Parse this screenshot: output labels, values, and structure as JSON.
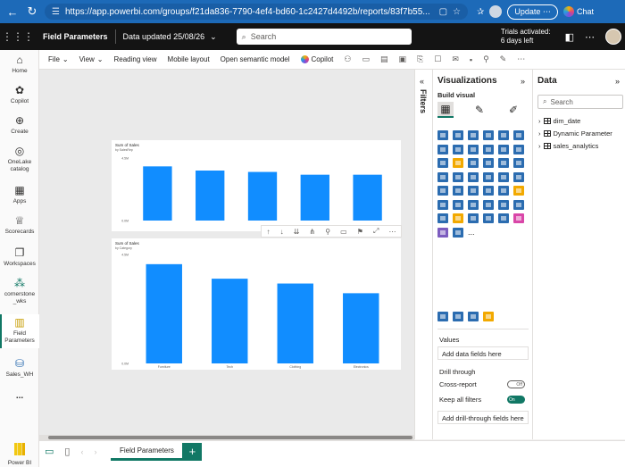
{
  "browser": {
    "url": "https://app.powerbi.com/groups/f21da836-7790-4ef4-bd60-1c2427d4492b/reports/83f7b55...",
    "update_label": "Update",
    "chat_label": "Chat"
  },
  "header": {
    "report_name": "Field Parameters",
    "updated_text": "Data updated 25/08/26",
    "search_placeholder": "Search",
    "trial_line1": "Trials activated:",
    "trial_line2": "6 days left"
  },
  "rail": [
    {
      "label": "Home"
    },
    {
      "label": "Copilot"
    },
    {
      "label": "Create"
    },
    {
      "label": "OneLake catalog"
    },
    {
      "label": "Apps"
    },
    {
      "label": "Scorecards"
    },
    {
      "label": "Workspaces"
    },
    {
      "label": "cornerstone _wks"
    },
    {
      "label": "Field Parameters"
    },
    {
      "label": "Sales_WH"
    },
    {
      "label": "..."
    },
    {
      "label": "Power BI"
    }
  ],
  "ribbon": {
    "file": "File",
    "view": "View",
    "reading_view": "Reading view",
    "mobile_layout": "Mobile layout",
    "open_model": "Open semantic model",
    "copilot": "Copilot"
  },
  "filters_label": "Filters",
  "viz": {
    "title": "Visualizations",
    "build_visual": "Build visual",
    "more": "...",
    "values_label": "Values",
    "add_data_fields": "Add data fields here",
    "drill_through": "Drill through",
    "cross_report": "Cross-report",
    "cross_report_state": "Off",
    "keep_filters": "Keep all filters",
    "keep_filters_state": "On",
    "add_drill": "Add drill-through fields here",
    "icon_colors": [
      "#2b6cb0",
      "#2b6cb0",
      "#2b6cb0",
      "#2b6cb0",
      "#2b6cb0",
      "#2b6cb0",
      "#2b6cb0",
      "#2b6cb0",
      "#2b6cb0",
      "#2b6cb0",
      "#2b6cb0",
      "#2b6cb0",
      "#2b6cb0",
      "#f2a900",
      "#2b6cb0",
      "#2b6cb0",
      "#2b6cb0",
      "#2b6cb0",
      "#2b6cb0",
      "#2b6cb0",
      "#2b6cb0",
      "#2b6cb0",
      "#2b6cb0",
      "#2b6cb0",
      "#2b6cb0",
      "#2b6cb0",
      "#2b6cb0",
      "#2b6cb0",
      "#2b6cb0",
      "#f2a900",
      "#2b6cb0",
      "#2b6cb0",
      "#2b6cb0",
      "#2b6cb0",
      "#2b6cb0",
      "#2b6cb0",
      "#2b6cb0",
      "#f2a900",
      "#2b6cb0",
      "#2b6cb0",
      "#2b6cb0",
      "#d946a8",
      "#7c5cbf",
      "#2b6cb0"
    ]
  },
  "data_pane": {
    "title": "Data",
    "search_placeholder": "Search",
    "tables": [
      "dim_date",
      "Dynamic Parameter",
      "sales_analytics"
    ]
  },
  "pages": {
    "active_tab": "Field Parameters"
  },
  "chart_data": [
    {
      "type": "bar",
      "title": "Sum of Sales",
      "subtitle": "by SalesRep",
      "categories": [
        "",
        "",
        "",
        "",
        ""
      ],
      "values": [
        3.9,
        3.6,
        3.5,
        3.3,
        3.3
      ],
      "ylim": [
        0,
        4.5
      ],
      "yticks": [
        "0.0M",
        "",
        "",
        "4.5M"
      ],
      "color": "#118dff"
    },
    {
      "type": "bar",
      "title": "Sum of Sales",
      "subtitle": "by Category",
      "categories": [
        "Furniture",
        "Tech",
        "Clothing",
        "Electronics"
      ],
      "values": [
        4.1,
        3.5,
        3.3,
        2.9
      ],
      "ylim": [
        0,
        4.5
      ],
      "yticks": [
        "0.0M",
        "",
        "",
        "",
        "4.5M"
      ],
      "color": "#118dff"
    }
  ]
}
